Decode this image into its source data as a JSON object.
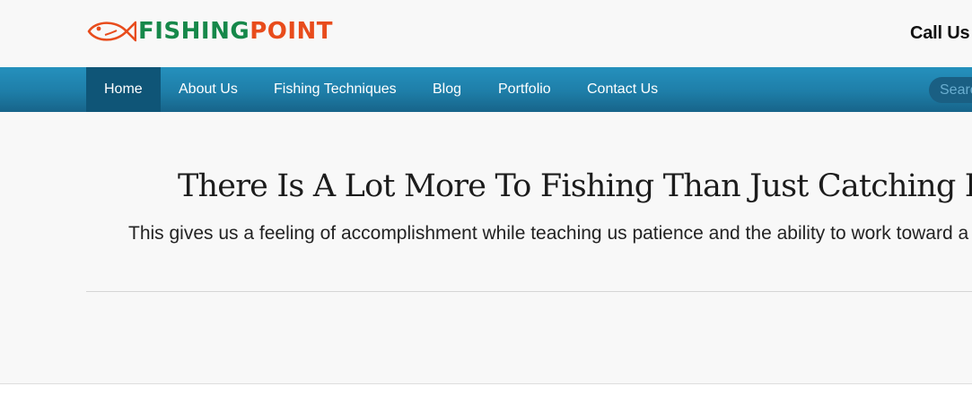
{
  "brand": {
    "name_part1": "FISHING",
    "name_part2": "POINT",
    "icon": "fish-icon",
    "colors": {
      "green": "#16884a",
      "orange": "#e84c1c"
    }
  },
  "header": {
    "call_us": "Call Us"
  },
  "nav": {
    "items": [
      {
        "label": "Home",
        "active": true
      },
      {
        "label": "About Us",
        "active": false
      },
      {
        "label": "Fishing Techniques",
        "active": false
      },
      {
        "label": "Blog",
        "active": false
      },
      {
        "label": "Portfolio",
        "active": false
      },
      {
        "label": "Contact Us",
        "active": false
      }
    ],
    "search_placeholder": "Search",
    "colors": {
      "bar": "#1e7ea8",
      "active": "#0f5577"
    }
  },
  "hero": {
    "title": "There Is A Lot More To Fishing Than Just Catching Fish",
    "subtitle": "This gives us a feeling of accomplishment while teaching us patience and the ability to work toward a goal."
  }
}
